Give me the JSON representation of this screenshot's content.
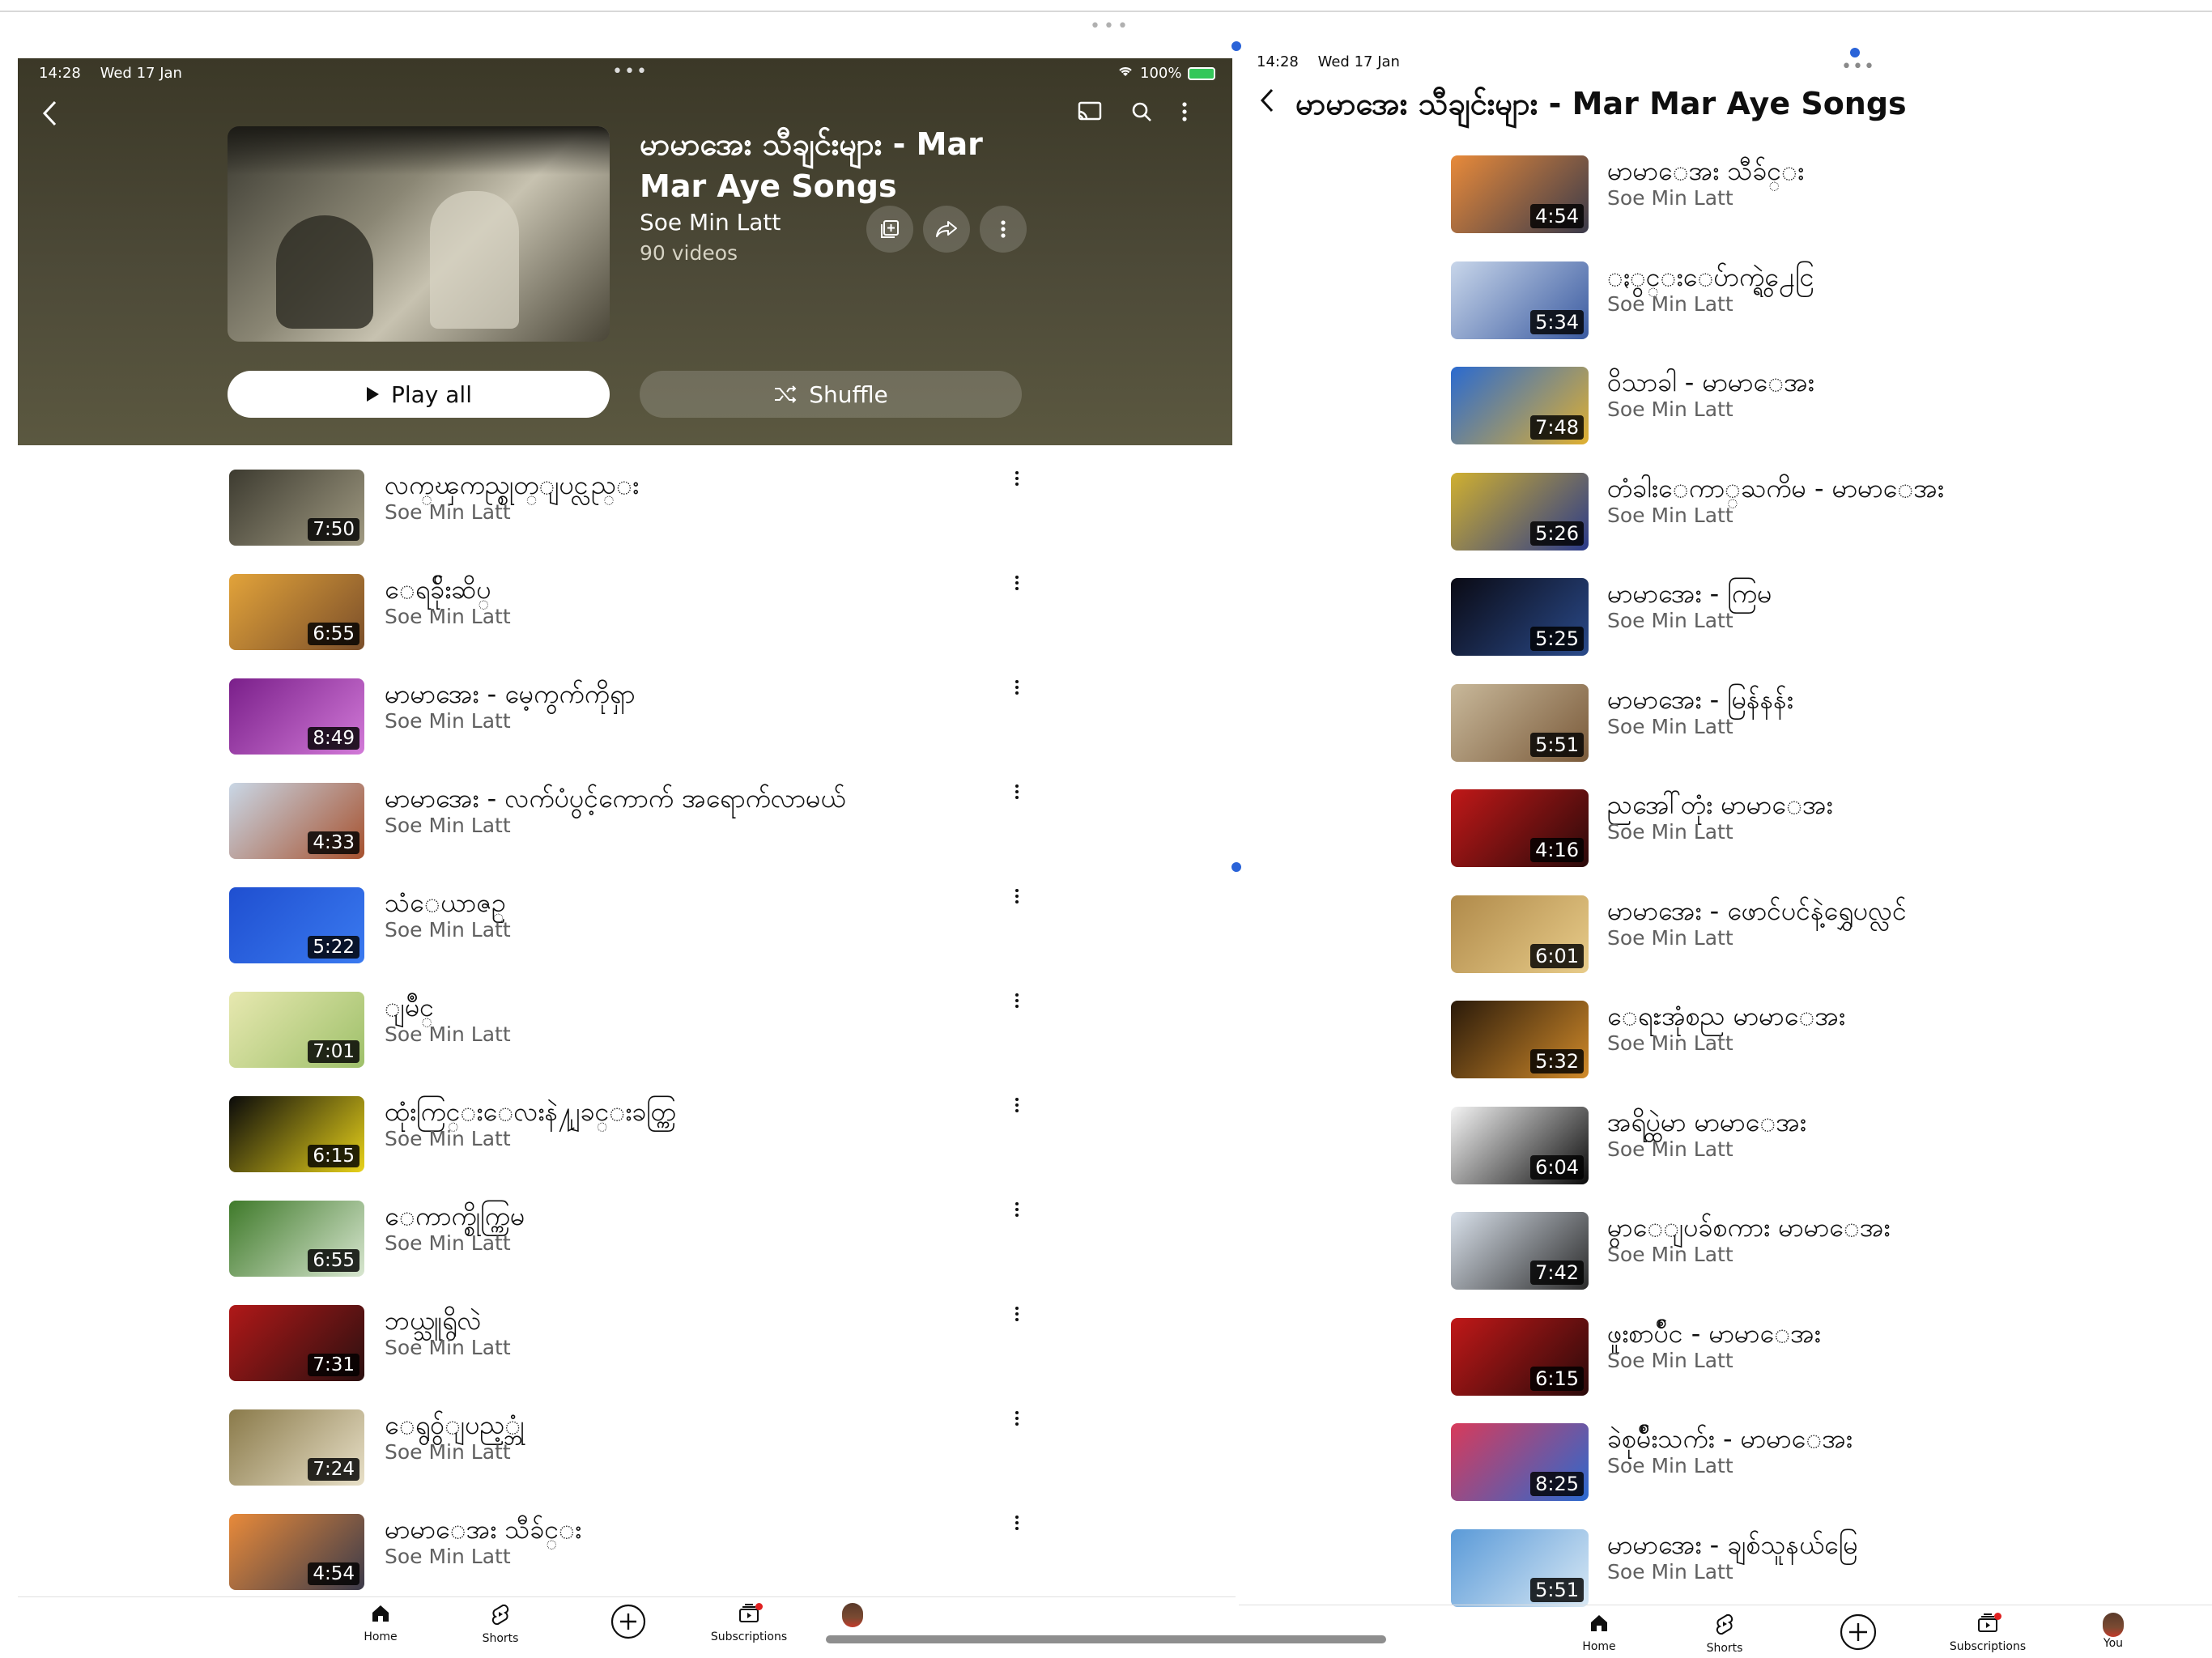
{
  "left": {
    "status": {
      "time": "14:28",
      "date": "Wed 17 Jan",
      "battery": "100%"
    },
    "playlist": {
      "title": "မာမာအေး သီချင်းများ - Mar Mar Aye Songs",
      "channel": "Soe Min Latt",
      "count": "90 videos",
      "play_all": "Play all",
      "shuffle": "Shuffle"
    },
    "videos": [
      {
        "title": "လက္ၾကည္စုတ္ျပင္လည္း",
        "channel": "Soe Min Latt",
        "duration": "7:50",
        "thumb_a": "#3d3b30",
        "thumb_b": "#a09a82"
      },
      {
        "title": "ေရခ်ိုးဆိပ္",
        "channel": "Soe Min Latt",
        "duration": "6:55",
        "thumb_a": "#e2a33a",
        "thumb_b": "#7a4e2a"
      },
      {
        "title": "မာမာအေး - မေ့ကွက်ကိုရှာ",
        "channel": "Soe Min Latt",
        "duration": "8:49",
        "thumb_a": "#7a1f8a",
        "thumb_b": "#d27ad8"
      },
      {
        "title": "မာမာအေး - လက်ပံပွင့်ကောက် အရောက်လာမယ်",
        "channel": "Soe Min Latt",
        "duration": "4:33",
        "thumb_a": "#c9d7e6",
        "thumb_b": "#a6512e"
      },
      {
        "title": "သံေယာဇဥ္",
        "channel": "Soe Min Latt",
        "duration": "5:22",
        "thumb_a": "#1f4fd0",
        "thumb_b": "#3a7af0"
      },
      {
        "title": "ျမိဳင္",
        "channel": "Soe Min Latt",
        "duration": "7:01",
        "thumb_a": "#e7e8b0",
        "thumb_b": "#9ec06a"
      },
      {
        "title": "ထုံးကြင္းေလးနဲ႔ျခင္းခတ္ကြ",
        "channel": "Soe Min Latt",
        "duration": "6:15",
        "thumb_a": "#0a0a0a",
        "thumb_b": "#e8d21a"
      },
      {
        "title": "ေကာက္စိုက္ကြမ",
        "channel": "Soe Min Latt",
        "duration": "6:55",
        "thumb_a": "#3f7a2a",
        "thumb_b": "#d8e6d0"
      },
      {
        "title": "ဘယ္သူရွိလဲ",
        "channel": "Soe Min Latt",
        "duration": "7:31",
        "thumb_a": "#b01818",
        "thumb_b": "#2a1010"
      },
      {
        "title": "ေရွ၀ွ်ျပည့္ဘုံ",
        "channel": "Soe Min Latt",
        "duration": "7:24",
        "thumb_a": "#8a7a4a",
        "thumb_b": "#e8e0c8"
      },
      {
        "title": "မာမာေအး သီခ်င္း",
        "channel": "Soe Min Latt",
        "duration": "4:54",
        "thumb_a": "#e88a3a",
        "thumb_b": "#3a3a4a"
      }
    ]
  },
  "right": {
    "status": {
      "time": "14:28",
      "date": "Wed 17 Jan"
    },
    "title": "မာမာအေး သီချင်းများ - Mar Mar Aye Songs",
    "videos": [
      {
        "title": "မာမာေအး သီခ်င္း",
        "channel": "Soe Min Latt",
        "duration": "4:54",
        "thumb_a": "#e88a3a",
        "thumb_b": "#3a3a4a"
      },
      {
        "title": "ႏွင္းေပ်ာက္ရွဲ႕ေငြ",
        "channel": "Soe Min Latt",
        "duration": "5:34",
        "thumb_a": "#c8d6ea",
        "thumb_b": "#3a5aa0"
      },
      {
        "title": "ဝိသာခါ - မာမာေအး",
        "channel": "Soe Min Latt",
        "duration": "7:48",
        "thumb_a": "#2a6ad0",
        "thumb_b": "#e0b030"
      },
      {
        "title": "တံခါးေကာ္ႀကိမ - မာမာေအး",
        "channel": "Soe Min Latt",
        "duration": "5:26",
        "thumb_a": "#d0b030",
        "thumb_b": "#2a3a8a"
      },
      {
        "title": "မာမာအေး - ကြမ",
        "channel": "Soe Min Latt",
        "duration": "5:25",
        "thumb_a": "#0a0a14",
        "thumb_b": "#2a4a8a"
      },
      {
        "title": "မာမာအေး - မြန်နန်း",
        "channel": "Soe Min Latt",
        "duration": "5:51",
        "thumb_a": "#c8b89a",
        "thumb_b": "#7a5a3a"
      },
      {
        "title": "ညအေါ်တုံး  မာမာေအး",
        "channel": "Soe Min Latt",
        "duration": "4:16",
        "thumb_a": "#c01818",
        "thumb_b": "#2a0a0a"
      },
      {
        "title": "မာမာအေး - ဖောင်ပင်နဲ့ရွှေပလ္လင်",
        "channel": "Soe Min Latt",
        "duration": "6:01",
        "thumb_a": "#b08a4a",
        "thumb_b": "#e8cc8a"
      },
      {
        "title": "ေရႊအုံစည  မာမာေအး",
        "channel": "Soe Min Latt",
        "duration": "5:32",
        "thumb_a": "#2a1a0a",
        "thumb_b": "#d08a2a"
      },
      {
        "title": "အရိပ္ထဲမာ  မာမာေအး",
        "channel": "Soe Min Latt",
        "duration": "6:04",
        "thumb_a": "#f4f4f4",
        "thumb_b": "#0a0a0a"
      },
      {
        "title": "မွာေျပခ်စကား  မာမာေအး",
        "channel": "Soe Min Latt",
        "duration": "7:42",
        "thumb_a": "#d8e0ea",
        "thumb_b": "#2a2a2a"
      },
      {
        "title": "ဖူးစာပ်ဳင - မာမာေအး",
        "channel": "Soe Min Latt",
        "duration": "6:15",
        "thumb_a": "#c01818",
        "thumb_b": "#2a0a0a"
      },
      {
        "title": "ခဲစုမ်ိဳးသက်း - မာမာေအး",
        "channel": "Soe Min Latt",
        "duration": "8:25",
        "thumb_a": "#d83a5a",
        "thumb_b": "#2a6ad0"
      },
      {
        "title": "မာမာအေး - ချစ်သူနယ်မြေ",
        "channel": "Soe Min Latt",
        "duration": "5:51",
        "thumb_a": "#5a9ad8",
        "thumb_b": "#d8e8f4"
      }
    ]
  },
  "nav": {
    "home": "Home",
    "shorts": "Shorts",
    "subscriptions": "Subscriptions",
    "you": "You"
  },
  "icons": {
    "back": "chevron-left-icon",
    "cast": "cast-icon",
    "search": "search-icon",
    "more": "more-vertical-icon",
    "save": "save-to-library-icon",
    "share": "share-icon",
    "play": "play-icon",
    "shuffle": "shuffle-icon",
    "create": "plus-circle-icon"
  },
  "colors": {
    "header_bg": "#4a4736",
    "accent_dot": "#2a63d8",
    "badge_red": "#e02020"
  }
}
